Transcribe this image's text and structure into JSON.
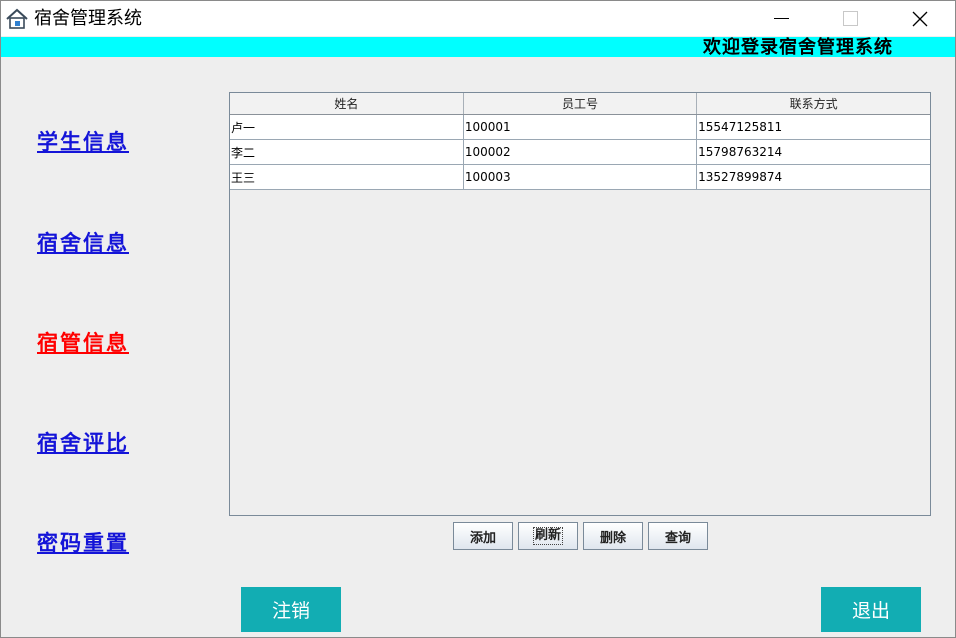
{
  "window": {
    "title": "宿舍管理系统",
    "icon": "house-icon"
  },
  "banner": {
    "text": "欢迎登录宿舍管理系统",
    "color": "#00ffff"
  },
  "nav": {
    "items": [
      {
        "label": "学生信息",
        "active": false
      },
      {
        "label": "宿舍信息",
        "active": false
      },
      {
        "label": "宿管信息",
        "active": true
      },
      {
        "label": "宿舍评比",
        "active": false
      },
      {
        "label": "密码重置",
        "active": false
      }
    ],
    "link_color": "#1414d8",
    "active_color": "#ff0000"
  },
  "table": {
    "headers": [
      "姓名",
      "员工号",
      "联系方式"
    ],
    "rows": [
      [
        "卢一",
        "100001",
        "15547125811"
      ],
      [
        "李二",
        "100002",
        "15798763214"
      ],
      [
        "王三",
        "100003",
        "13527899874"
      ]
    ]
  },
  "actions": {
    "add": "添加",
    "refresh": "刷新",
    "delete": "删除",
    "query": "查询"
  },
  "footer": {
    "logout": "注销",
    "exit": "退出",
    "button_color": "#12adb3"
  }
}
